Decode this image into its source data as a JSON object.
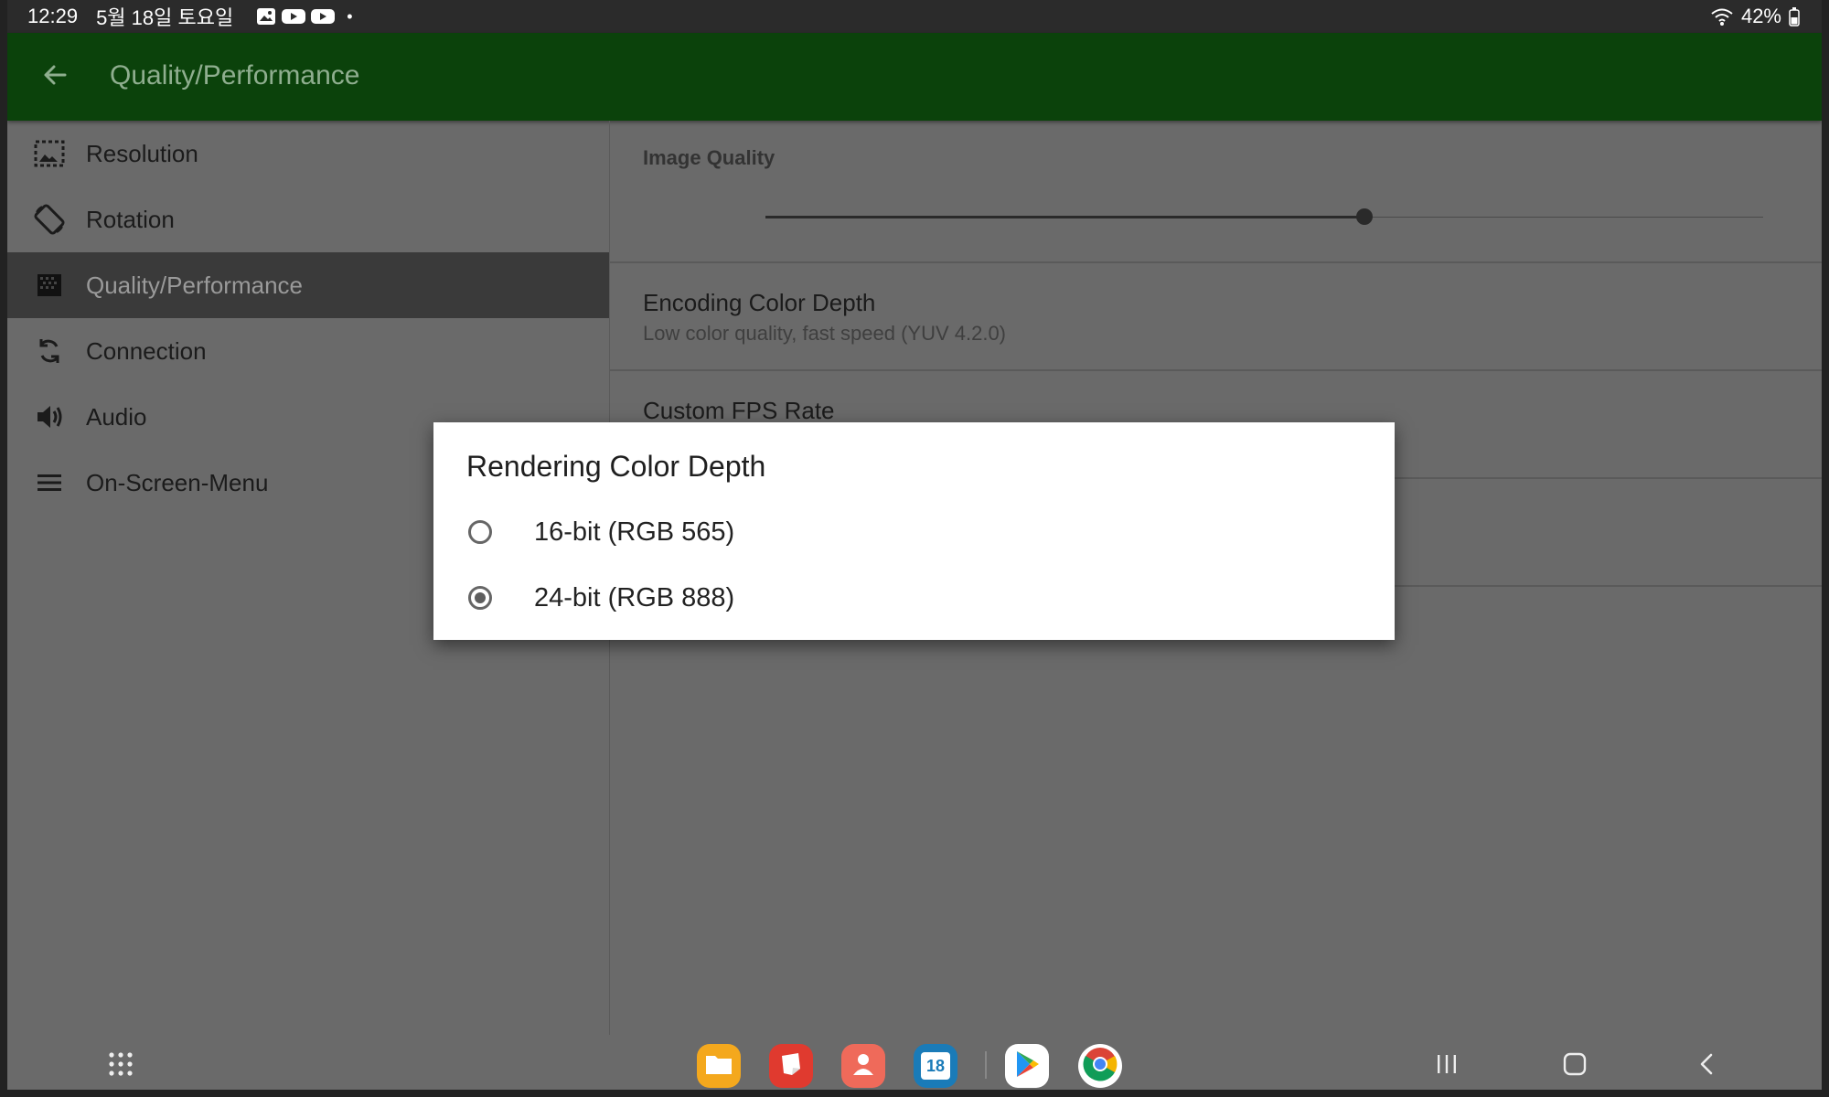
{
  "status_bar": {
    "time": "12:29",
    "date": "5월 18일 토요일",
    "notification_icons": [
      "gallery-icon",
      "youtube-icon",
      "youtube-icon"
    ],
    "dot": "•",
    "battery": "42%"
  },
  "app_bar": {
    "title": "Quality/Performance"
  },
  "sidebar": {
    "items": [
      {
        "label": "Resolution",
        "icon": "resolution-icon",
        "active": false
      },
      {
        "label": "Rotation",
        "icon": "rotation-icon",
        "active": false
      },
      {
        "label": "Quality/Performance",
        "icon": "quality-icon",
        "active": true
      },
      {
        "label": "Connection",
        "icon": "connection-icon",
        "active": false
      },
      {
        "label": "Audio",
        "icon": "audio-icon",
        "active": false
      },
      {
        "label": "On-Screen-Menu",
        "icon": "menu-icon",
        "active": false
      }
    ]
  },
  "settings": {
    "image_quality": {
      "label": "Image Quality",
      "slider_value": 0.6
    },
    "encoding": {
      "title": "Encoding Color Depth",
      "subtitle": "Low color quality, fast speed (YUV 4.2.0)"
    },
    "custom_fps": {
      "title": "Custom FPS Rate"
    }
  },
  "dialog": {
    "title": "Rendering Color Depth",
    "options": [
      {
        "label": "16-bit (RGB 565)",
        "checked": false
      },
      {
        "label": "24-bit (RGB 888)",
        "checked": true
      }
    ]
  },
  "dock": {
    "calendar_day": "18",
    "apps": [
      "files-icon",
      "notes-icon",
      "contacts-icon",
      "calendar-icon",
      "play-store-icon",
      "chrome-icon"
    ]
  },
  "colors": {
    "app_bar": "#0b420b",
    "background": "#6a6a6a",
    "active_item": "#3a3a3a"
  }
}
